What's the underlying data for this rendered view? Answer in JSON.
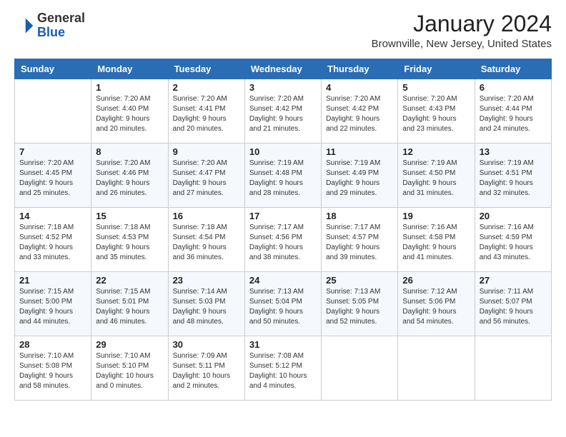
{
  "header": {
    "logo_general": "General",
    "logo_blue": "Blue",
    "title": "January 2024",
    "subtitle": "Brownville, New Jersey, United States"
  },
  "weekdays": [
    "Sunday",
    "Monday",
    "Tuesday",
    "Wednesday",
    "Thursday",
    "Friday",
    "Saturday"
  ],
  "weeks": [
    [
      {
        "day": "",
        "info": ""
      },
      {
        "day": "1",
        "info": "Sunrise: 7:20 AM\nSunset: 4:40 PM\nDaylight: 9 hours\nand 20 minutes."
      },
      {
        "day": "2",
        "info": "Sunrise: 7:20 AM\nSunset: 4:41 PM\nDaylight: 9 hours\nand 20 minutes."
      },
      {
        "day": "3",
        "info": "Sunrise: 7:20 AM\nSunset: 4:42 PM\nDaylight: 9 hours\nand 21 minutes."
      },
      {
        "day": "4",
        "info": "Sunrise: 7:20 AM\nSunset: 4:42 PM\nDaylight: 9 hours\nand 22 minutes."
      },
      {
        "day": "5",
        "info": "Sunrise: 7:20 AM\nSunset: 4:43 PM\nDaylight: 9 hours\nand 23 minutes."
      },
      {
        "day": "6",
        "info": "Sunrise: 7:20 AM\nSunset: 4:44 PM\nDaylight: 9 hours\nand 24 minutes."
      }
    ],
    [
      {
        "day": "7",
        "info": "Sunrise: 7:20 AM\nSunset: 4:45 PM\nDaylight: 9 hours\nand 25 minutes."
      },
      {
        "day": "8",
        "info": "Sunrise: 7:20 AM\nSunset: 4:46 PM\nDaylight: 9 hours\nand 26 minutes."
      },
      {
        "day": "9",
        "info": "Sunrise: 7:20 AM\nSunset: 4:47 PM\nDaylight: 9 hours\nand 27 minutes."
      },
      {
        "day": "10",
        "info": "Sunrise: 7:19 AM\nSunset: 4:48 PM\nDaylight: 9 hours\nand 28 minutes."
      },
      {
        "day": "11",
        "info": "Sunrise: 7:19 AM\nSunset: 4:49 PM\nDaylight: 9 hours\nand 29 minutes."
      },
      {
        "day": "12",
        "info": "Sunrise: 7:19 AM\nSunset: 4:50 PM\nDaylight: 9 hours\nand 31 minutes."
      },
      {
        "day": "13",
        "info": "Sunrise: 7:19 AM\nSunset: 4:51 PM\nDaylight: 9 hours\nand 32 minutes."
      }
    ],
    [
      {
        "day": "14",
        "info": "Sunrise: 7:18 AM\nSunset: 4:52 PM\nDaylight: 9 hours\nand 33 minutes."
      },
      {
        "day": "15",
        "info": "Sunrise: 7:18 AM\nSunset: 4:53 PM\nDaylight: 9 hours\nand 35 minutes."
      },
      {
        "day": "16",
        "info": "Sunrise: 7:18 AM\nSunset: 4:54 PM\nDaylight: 9 hours\nand 36 minutes."
      },
      {
        "day": "17",
        "info": "Sunrise: 7:17 AM\nSunset: 4:56 PM\nDaylight: 9 hours\nand 38 minutes."
      },
      {
        "day": "18",
        "info": "Sunrise: 7:17 AM\nSunset: 4:57 PM\nDaylight: 9 hours\nand 39 minutes."
      },
      {
        "day": "19",
        "info": "Sunrise: 7:16 AM\nSunset: 4:58 PM\nDaylight: 9 hours\nand 41 minutes."
      },
      {
        "day": "20",
        "info": "Sunrise: 7:16 AM\nSunset: 4:59 PM\nDaylight: 9 hours\nand 43 minutes."
      }
    ],
    [
      {
        "day": "21",
        "info": "Sunrise: 7:15 AM\nSunset: 5:00 PM\nDaylight: 9 hours\nand 44 minutes."
      },
      {
        "day": "22",
        "info": "Sunrise: 7:15 AM\nSunset: 5:01 PM\nDaylight: 9 hours\nand 46 minutes."
      },
      {
        "day": "23",
        "info": "Sunrise: 7:14 AM\nSunset: 5:03 PM\nDaylight: 9 hours\nand 48 minutes."
      },
      {
        "day": "24",
        "info": "Sunrise: 7:13 AM\nSunset: 5:04 PM\nDaylight: 9 hours\nand 50 minutes."
      },
      {
        "day": "25",
        "info": "Sunrise: 7:13 AM\nSunset: 5:05 PM\nDaylight: 9 hours\nand 52 minutes."
      },
      {
        "day": "26",
        "info": "Sunrise: 7:12 AM\nSunset: 5:06 PM\nDaylight: 9 hours\nand 54 minutes."
      },
      {
        "day": "27",
        "info": "Sunrise: 7:11 AM\nSunset: 5:07 PM\nDaylight: 9 hours\nand 56 minutes."
      }
    ],
    [
      {
        "day": "28",
        "info": "Sunrise: 7:10 AM\nSunset: 5:08 PM\nDaylight: 9 hours\nand 58 minutes."
      },
      {
        "day": "29",
        "info": "Sunrise: 7:10 AM\nSunset: 5:10 PM\nDaylight: 10 hours\nand 0 minutes."
      },
      {
        "day": "30",
        "info": "Sunrise: 7:09 AM\nSunset: 5:11 PM\nDaylight: 10 hours\nand 2 minutes."
      },
      {
        "day": "31",
        "info": "Sunrise: 7:08 AM\nSunset: 5:12 PM\nDaylight: 10 hours\nand 4 minutes."
      },
      {
        "day": "",
        "info": ""
      },
      {
        "day": "",
        "info": ""
      },
      {
        "day": "",
        "info": ""
      }
    ]
  ]
}
